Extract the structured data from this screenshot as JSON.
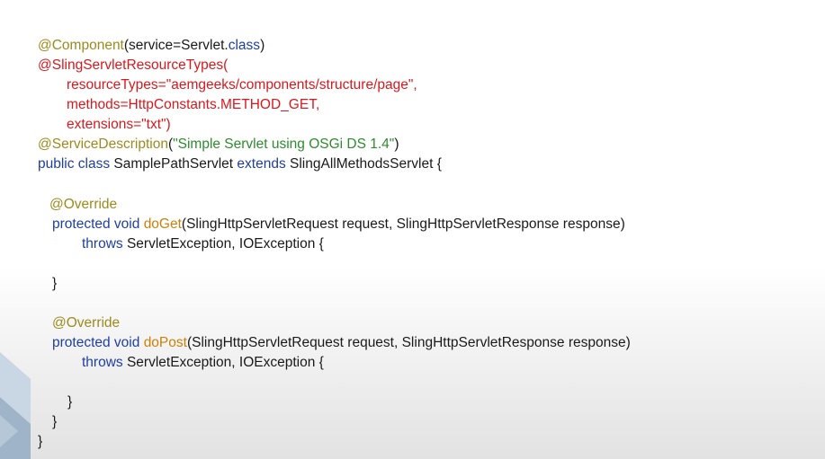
{
  "code": {
    "l1_annotation": "@Component",
    "l1_open": "(service=Servlet.",
    "l1_class_kw": "class",
    "l1_close": ")",
    "l2": "@SlingServletResourceTypes(",
    "l3": "resourceTypes=\"aemgeeks/components/structure/page\",",
    "l4": "methods=HttpConstants.METHOD_GET,",
    "l5": "extensions=\"txt\")",
    "l6_annotation": "@ServiceDescription",
    "l6_open": "(",
    "l6_string": "\"Simple Servlet using OSGi DS 1.4\"",
    "l6_close": ")",
    "l7_public_class": "public class",
    "l7_name": " SamplePathServlet ",
    "l7_extends": "extends",
    "l7_rest": " SlingAllMethodsServlet {",
    "l8_override": "@Override",
    "l9_mods": "protected void",
    "l9_method": "doGet",
    "l9_params": "(SlingHttpServletRequest request, SlingHttpServletResponse response)",
    "l10_throws": "throws",
    "l10_rest": " ServletException, IOException {",
    "l11": "}",
    "l12_override": "@Override",
    "l13_mods": "protected void",
    "l13_method": "doPost",
    "l13_params": "(SlingHttpServletRequest request, SlingHttpServletResponse response)",
    "l14_throws": "throws",
    "l14_rest": " ServletException, IOException {",
    "l15": "}",
    "l16": "}",
    "l17": "}"
  },
  "colors": {
    "annotation": "#9c8a1e",
    "keyword": "#1f3fa0",
    "red": "#d9181d",
    "method": "#c9810c",
    "string": "#2e8b2e",
    "text": "#1a1a1a"
  }
}
